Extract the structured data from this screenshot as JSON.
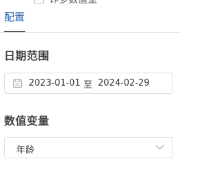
{
  "top_item": {
    "label": "诈多数值型"
  },
  "tabs": [
    {
      "label": "配置"
    }
  ],
  "date_section": {
    "title": "日期范围",
    "start": "2023-01-01",
    "separator": "至",
    "end": "2024-02-29"
  },
  "variable_section": {
    "title": "数值变量",
    "selected": "年龄"
  },
  "colors": {
    "accent": "#1f5fbf",
    "border": "#dcdfe6"
  },
  "icons": {
    "date": "calendar-icon",
    "select": "chevron-down-icon"
  }
}
